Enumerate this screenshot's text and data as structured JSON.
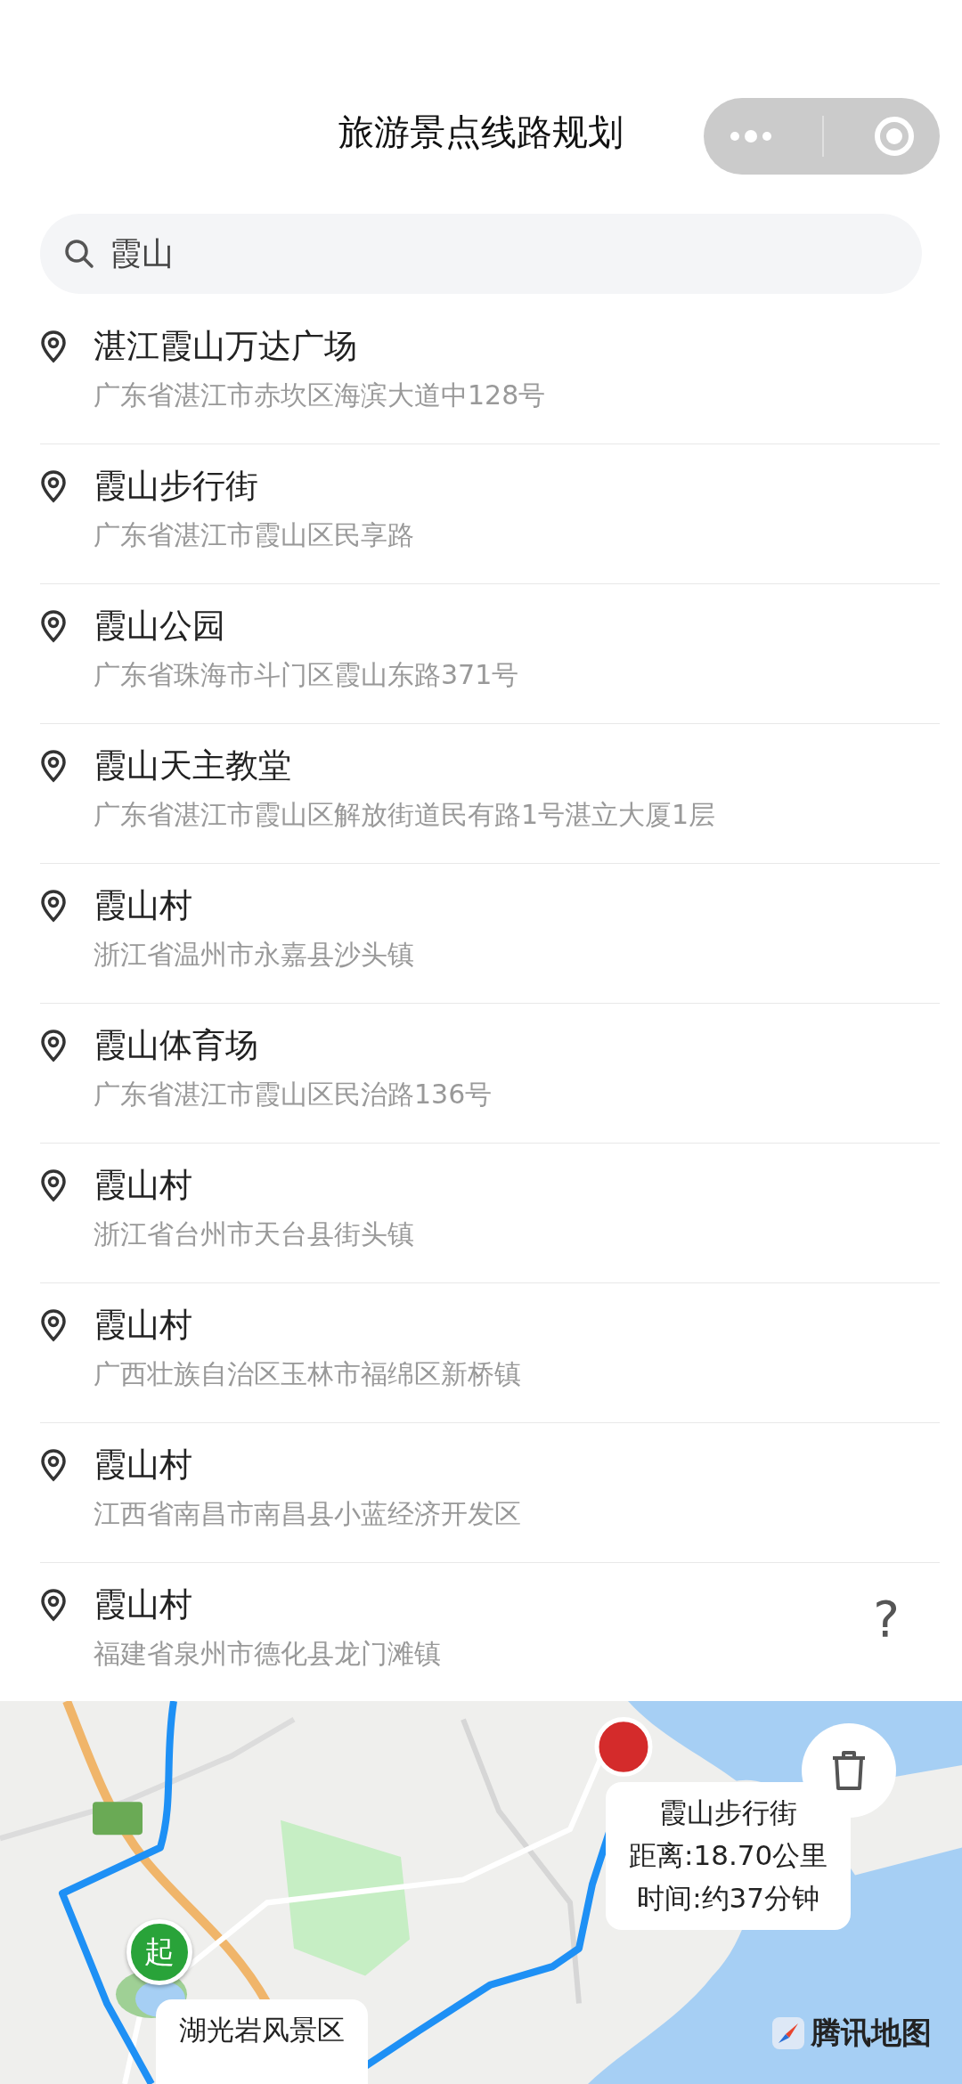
{
  "header": {
    "title": "旅游景点线路规划"
  },
  "search": {
    "value": "霞山"
  },
  "results": [
    {
      "name": "湛江霞山万达广场",
      "address": "广东省湛江市赤坎区海滨大道中128号"
    },
    {
      "name": "霞山步行街",
      "address": "广东省湛江市霞山区民享路"
    },
    {
      "name": "霞山公园",
      "address": "广东省珠海市斗门区霞山东路371号"
    },
    {
      "name": "霞山天主教堂",
      "address": "广东省湛江市霞山区解放街道民有路1号湛立大厦1层"
    },
    {
      "name": "霞山村",
      "address": "浙江省温州市永嘉县沙头镇"
    },
    {
      "name": "霞山体育场",
      "address": "广东省湛江市霞山区民治路136号"
    },
    {
      "name": "霞山村",
      "address": "浙江省台州市天台县街头镇"
    },
    {
      "name": "霞山村",
      "address": "广西壮族自治区玉林市福绵区新桥镇"
    },
    {
      "name": "霞山村",
      "address": "江西省南昌市南昌县小蓝经济开发区"
    },
    {
      "name": "霞山村",
      "address": "福建省泉州市德化县龙门滩镇"
    }
  ],
  "help": {
    "label": "?"
  },
  "map": {
    "start_marker": "起",
    "callouts": [
      {
        "lines": [
          "霞山步行街",
          "距离:18.70公里",
          "时间:约37分钟"
        ]
      },
      {
        "lines": [
          "湖光岩风景区"
        ]
      }
    ],
    "logo": "腾讯地图"
  }
}
